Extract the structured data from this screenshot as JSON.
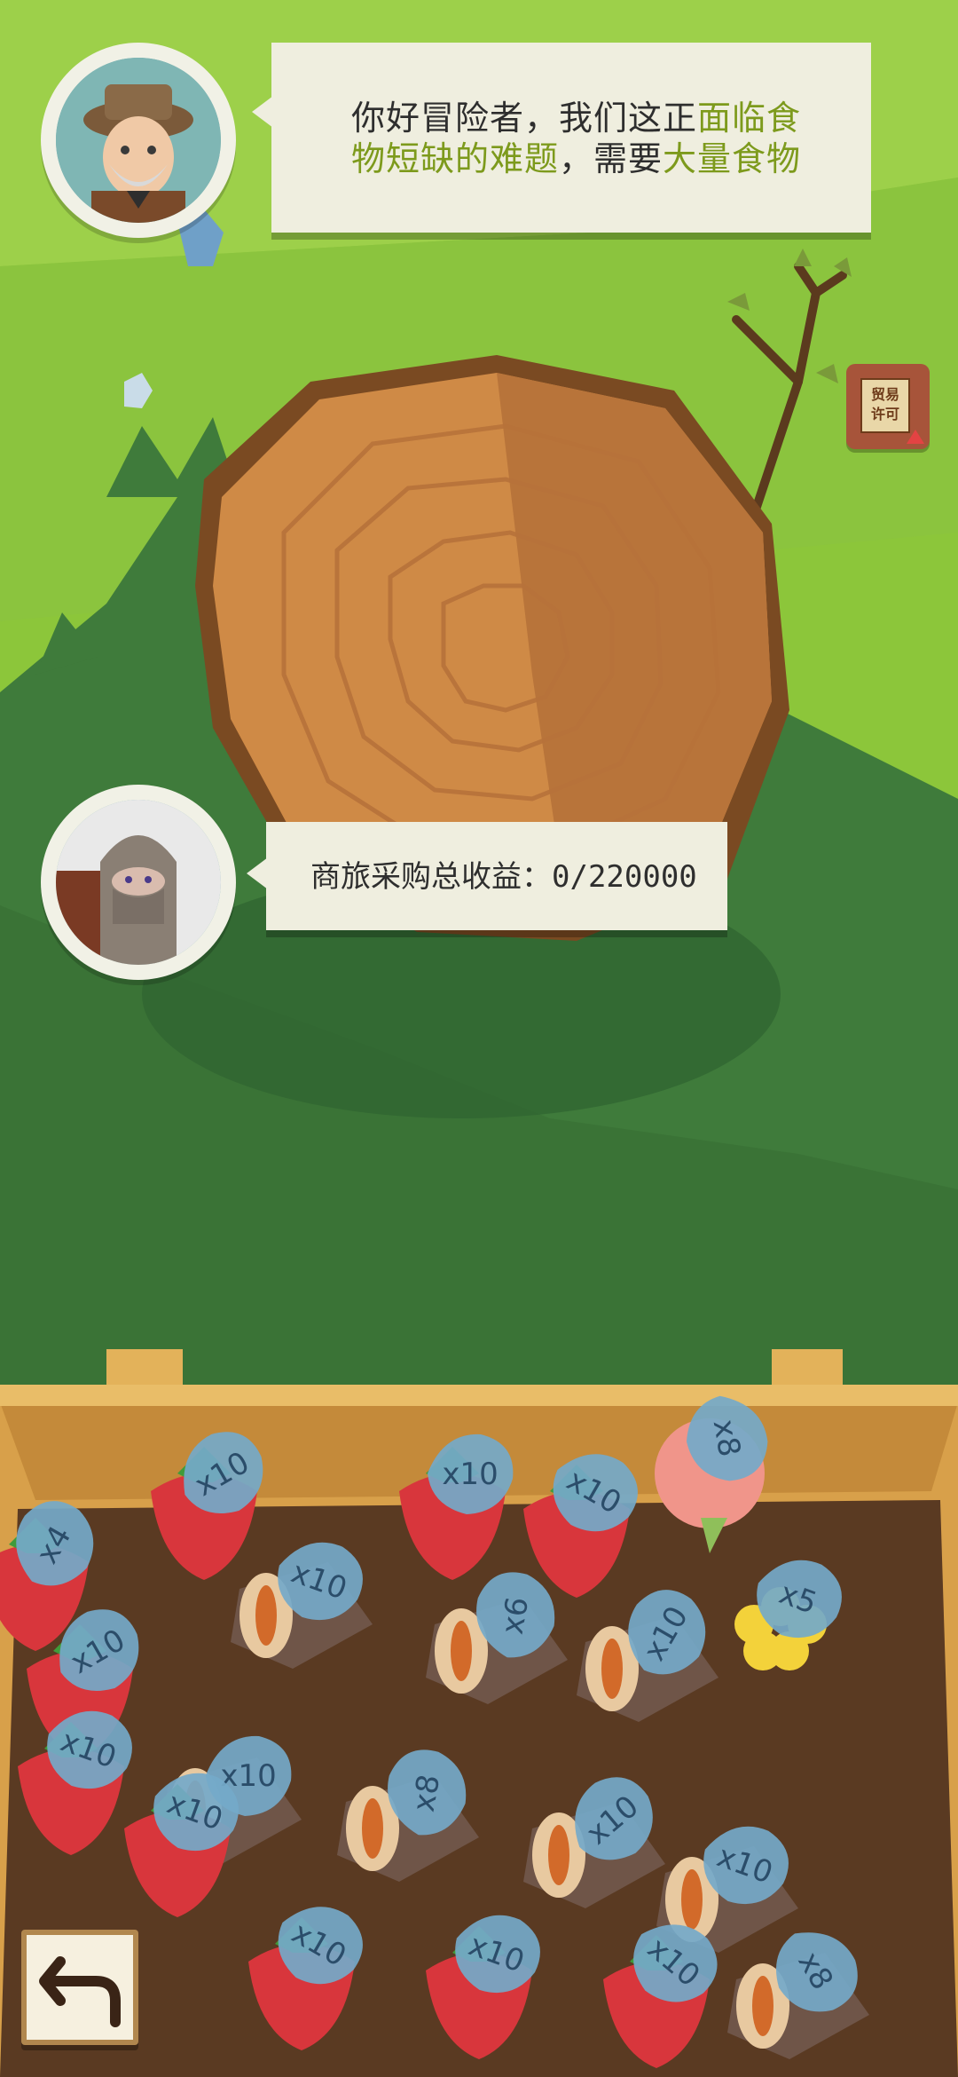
{
  "dialog": {
    "line1_plain": "你好冒险者，我们这正",
    "line1_highlight": "面临食",
    "line2_highlight_a": "物短缺的难题",
    "line2_plain": "，需要",
    "line2_highlight_b": "大量食物"
  },
  "revenue": {
    "text": "商旅采购总收益：0/220000"
  },
  "trade_permit": {
    "line1": "贸易",
    "line2": "许可"
  },
  "colors": {
    "highlight": "#7d9a1c",
    "grass_light": "#8cc63a",
    "grass_dark": "#3e7a3a",
    "tag_fill": "#74a9c9"
  },
  "food_items": [
    {
      "kind": "strawberry",
      "count": "x10"
    },
    {
      "kind": "strawberry",
      "count": "x10"
    },
    {
      "kind": "strawberry",
      "count": "x10"
    },
    {
      "kind": "peach",
      "count": "x8"
    },
    {
      "kind": "strawberry",
      "count": "x4"
    },
    {
      "kind": "meat-roll",
      "count": "x10"
    },
    {
      "kind": "meat-roll",
      "count": "x6"
    },
    {
      "kind": "meat-roll",
      "count": "x10"
    },
    {
      "kind": "flower",
      "count": "x5"
    },
    {
      "kind": "strawberry",
      "count": "x10"
    },
    {
      "kind": "strawberry",
      "count": "x10"
    },
    {
      "kind": "meat-roll",
      "count": "x10"
    },
    {
      "kind": "meat-roll",
      "count": "x8"
    },
    {
      "kind": "meat-roll",
      "count": "x10"
    },
    {
      "kind": "meat-roll",
      "count": "x10"
    },
    {
      "kind": "strawberry",
      "count": "x10"
    },
    {
      "kind": "strawberry",
      "count": "x10"
    },
    {
      "kind": "strawberry",
      "count": "x10"
    },
    {
      "kind": "strawberry",
      "count": "x10"
    },
    {
      "kind": "meat-roll",
      "count": "x8"
    }
  ]
}
